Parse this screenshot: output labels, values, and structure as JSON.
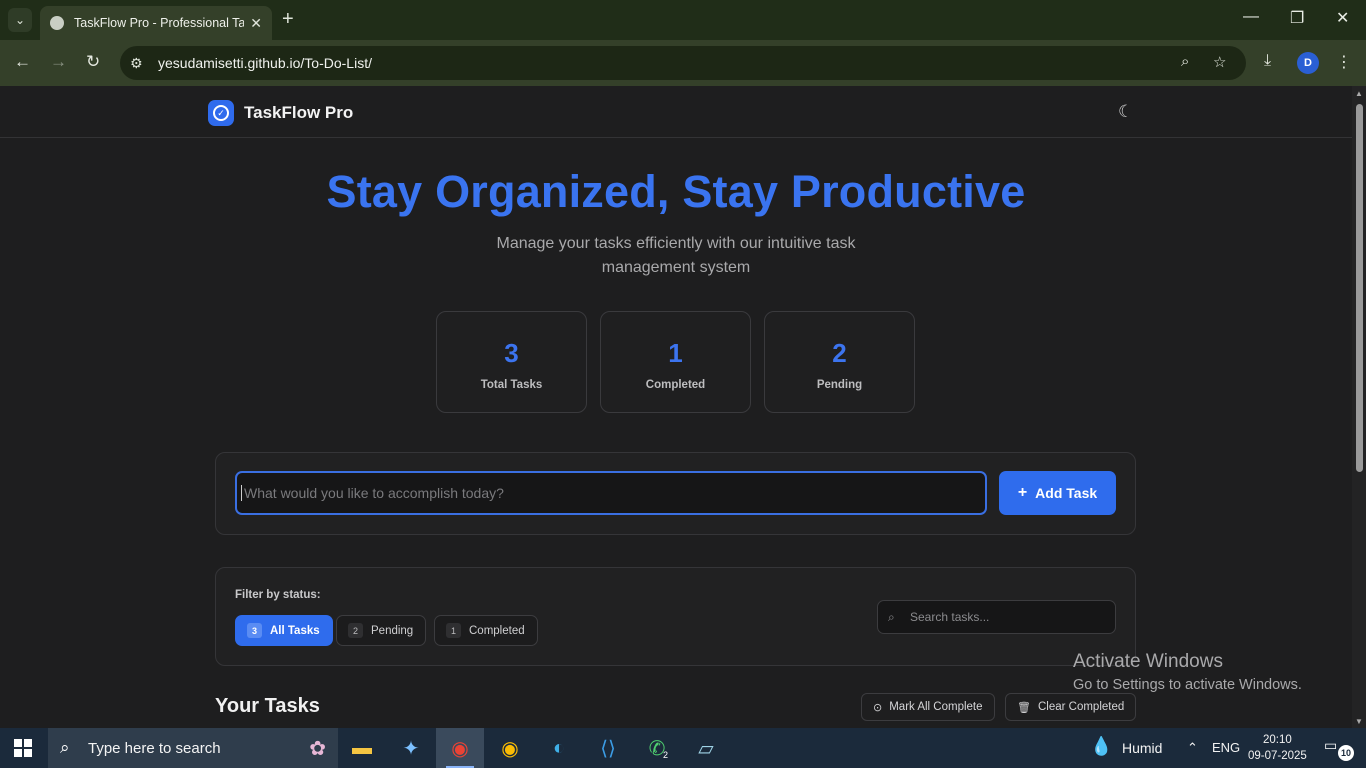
{
  "browser": {
    "tab_title": "TaskFlow Pro - Professional Task",
    "url": "yesudamisetti.github.io/To-Do-List/",
    "profile_initial": "D"
  },
  "app": {
    "brand": "TaskFlow Pro",
    "hero_title": "Stay Organized, Stay Productive",
    "hero_subtitle": "Manage your tasks efficiently with our intuitive task management system",
    "stats": [
      {
        "value": "3",
        "label": "Total Tasks"
      },
      {
        "value": "1",
        "label": "Completed"
      },
      {
        "value": "2",
        "label": "Pending"
      }
    ],
    "add_task": {
      "placeholder": "What would you like to accomplish today?",
      "button_label": "Add Task"
    },
    "filter": {
      "label": "Filter by status:",
      "pills": [
        {
          "count": "3",
          "label": "All Tasks"
        },
        {
          "count": "2",
          "label": "Pending"
        },
        {
          "count": "1",
          "label": "Completed"
        }
      ],
      "search_placeholder": "Search tasks..."
    },
    "tasks_heading": "Your Tasks",
    "actions": {
      "mark_all": "Mark All Complete",
      "clear_completed": "Clear Completed"
    }
  },
  "watermark": {
    "line1": "Activate Windows",
    "line2": "Go to Settings to activate Windows."
  },
  "taskbar": {
    "search_text": "Type here to search",
    "weather": "Humid",
    "language": "ENG",
    "time": "20:10",
    "date": "09-07-2025",
    "whatsapp_badge": "2",
    "notification_count": "10"
  },
  "colors": {
    "accent": "#2f6ced",
    "hero": "#3a74f0",
    "background": "#1e1e1f"
  }
}
